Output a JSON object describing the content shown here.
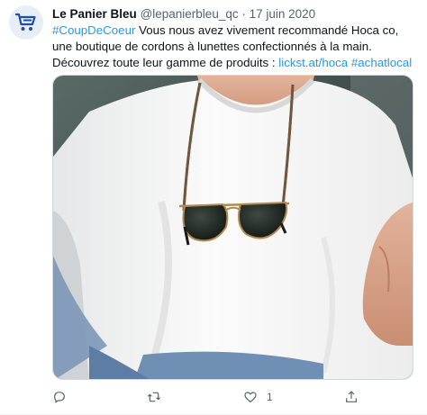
{
  "tweet": {
    "display_name": "Le Panier Bleu",
    "handle": "@lepanierbleu_qc",
    "separator": "·",
    "date": "17 juin 2020",
    "text": {
      "hashtag1": "#CoupDeCoeur",
      "body1": " Vous nous avez vivement recommandé Hoca co, une boutique de cordons à lunettes confectionnés à la main. Découvrez toute leur gamme de produits : ",
      "link": "lickst.at/hoca",
      "space": " ",
      "hashtag2": "#achatlocal"
    },
    "media": {
      "icon": "photo-man-wearing-glasses-cord",
      "colors": {
        "shirt": "#f4f4f4",
        "skin": "#d9a58a",
        "jeans": "#6f8fb5"
      }
    },
    "actions": {
      "reply": {
        "icon": "reply-icon",
        "count": ""
      },
      "retweet": {
        "icon": "retweet-icon",
        "count": ""
      },
      "like": {
        "icon": "heart-icon",
        "count": "1"
      },
      "share": {
        "icon": "share-icon",
        "count": ""
      }
    }
  },
  "colors": {
    "accent": "#1d9bf0",
    "muted": "#536471",
    "text": "#0f1419"
  }
}
